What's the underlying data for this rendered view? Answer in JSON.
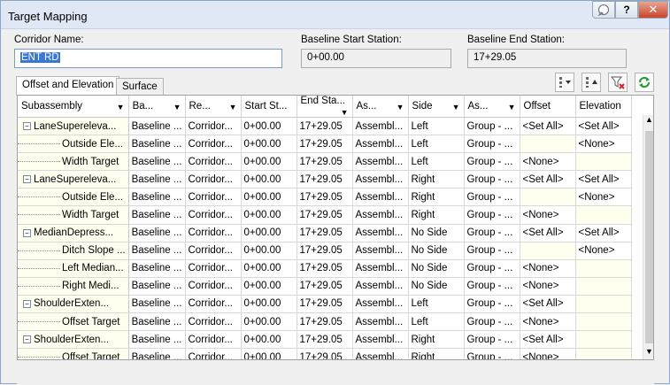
{
  "window": {
    "title": "Target Mapping",
    "help_icon": "balloon-help-icon",
    "question_label": "?",
    "close_label": "✕"
  },
  "corridor": {
    "label": "Corridor Name:",
    "value": "ENT RD"
  },
  "baseline_start": {
    "label": "Baseline Start Station:",
    "value": "0+00.00"
  },
  "baseline_end": {
    "label": "Baseline End Station:",
    "value": "17+29.05"
  },
  "tabs": [
    {
      "label": "Offset and Elevation"
    },
    {
      "label": "Surface"
    }
  ],
  "toolbar": [
    "column-chooser-icon",
    "sort-icon",
    "clear-filter-icon",
    "refresh-icon"
  ],
  "columns": [
    "Subassembly",
    "Ba...",
    "Re...",
    "Start St...",
    "End Sta...",
    "As...",
    "Side",
    "As...",
    "Offset",
    "Elevation"
  ],
  "rows": [
    {
      "sub": "LaneSupereleva...",
      "level": 0,
      "ba": "Baseline ...",
      "re": "Corridor...",
      "start": "0+00.00",
      "end": "17+29.05",
      "as1": "Assembl...",
      "side": "Left",
      "as2": "Group - ...",
      "offset": "<Set All>",
      "elev": "<Set All>"
    },
    {
      "sub": "Outside Ele...",
      "level": 1,
      "ba": "Baseline ...",
      "re": "Corridor...",
      "start": "0+00.00",
      "end": "17+29.05",
      "as1": "Assembl...",
      "side": "Left",
      "as2": "Group - ...",
      "offset": "",
      "elev": "<None>"
    },
    {
      "sub": "Width Target",
      "level": 1,
      "ba": "Baseline ...",
      "re": "Corridor...",
      "start": "0+00.00",
      "end": "17+29.05",
      "as1": "Assembl...",
      "side": "Left",
      "as2": "Group - ...",
      "offset": "<None>",
      "elev": ""
    },
    {
      "sub": "LaneSupereleva...",
      "level": 0,
      "ba": "Baseline ...",
      "re": "Corridor...",
      "start": "0+00.00",
      "end": "17+29.05",
      "as1": "Assembl...",
      "side": "Right",
      "as2": "Group - ...",
      "offset": "<Set All>",
      "elev": "<Set All>"
    },
    {
      "sub": "Outside Ele...",
      "level": 1,
      "ba": "Baseline ...",
      "re": "Corridor...",
      "start": "0+00.00",
      "end": "17+29.05",
      "as1": "Assembl...",
      "side": "Right",
      "as2": "Group - ...",
      "offset": "",
      "elev": "<None>"
    },
    {
      "sub": "Width Target",
      "level": 1,
      "ba": "Baseline ...",
      "re": "Corridor...",
      "start": "0+00.00",
      "end": "17+29.05",
      "as1": "Assembl...",
      "side": "Right",
      "as2": "Group - ...",
      "offset": "<None>",
      "elev": ""
    },
    {
      "sub": "MedianDepress...",
      "level": 0,
      "ba": "Baseline ...",
      "re": "Corridor...",
      "start": "0+00.00",
      "end": "17+29.05",
      "as1": "Assembl...",
      "side": "No Side",
      "as2": "Group - ...",
      "offset": "<Set All>",
      "elev": "<Set All>"
    },
    {
      "sub": "Ditch Slope ...",
      "level": 1,
      "ba": "Baseline ...",
      "re": "Corridor...",
      "start": "0+00.00",
      "end": "17+29.05",
      "as1": "Assembl...",
      "side": "No Side",
      "as2": "Group - ...",
      "offset": "",
      "elev": "<None>"
    },
    {
      "sub": "Left Median...",
      "level": 1,
      "ba": "Baseline ...",
      "re": "Corridor...",
      "start": "0+00.00",
      "end": "17+29.05",
      "as1": "Assembl...",
      "side": "No Side",
      "as2": "Group - ...",
      "offset": "<None>",
      "elev": ""
    },
    {
      "sub": "Right Medi...",
      "level": 1,
      "ba": "Baseline ...",
      "re": "Corridor...",
      "start": "0+00.00",
      "end": "17+29.05",
      "as1": "Assembl...",
      "side": "No Side",
      "as2": "Group - ...",
      "offset": "<None>",
      "elev": ""
    },
    {
      "sub": "ShoulderExten...",
      "level": 0,
      "ba": "Baseline ...",
      "re": "Corridor...",
      "start": "0+00.00",
      "end": "17+29.05",
      "as1": "Assembl...",
      "side": "Left",
      "as2": "Group - ...",
      "offset": "<Set All>",
      "elev": ""
    },
    {
      "sub": "Offset Target",
      "level": 1,
      "ba": "Baseline ...",
      "re": "Corridor...",
      "start": "0+00.00",
      "end": "17+29.05",
      "as1": "Assembl...",
      "side": "Left",
      "as2": "Group - ...",
      "offset": "<None>",
      "elev": ""
    },
    {
      "sub": "ShoulderExten...",
      "level": 0,
      "ba": "Baseline ...",
      "re": "Corridor...",
      "start": "0+00.00",
      "end": "17+29.05",
      "as1": "Assembl...",
      "side": "Right",
      "as2": "Group - ...",
      "offset": "<Set All>",
      "elev": ""
    },
    {
      "sub": "Offset Target",
      "level": 1,
      "ba": "Baseline ...",
      "re": "Corridor...",
      "start": "0+00.00",
      "end": "17+29.05",
      "as1": "Assembl...",
      "side": "Right",
      "as2": "Group - ...",
      "offset": "<None>",
      "elev": ""
    }
  ]
}
